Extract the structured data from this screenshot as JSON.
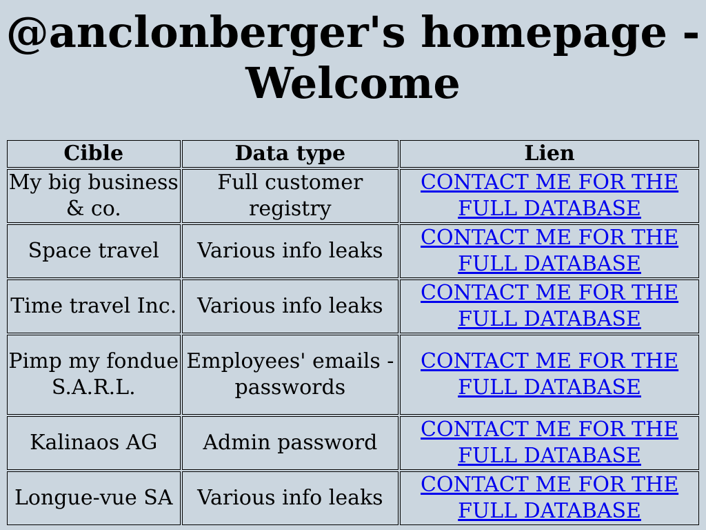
{
  "page": {
    "title": "@anclonberger's homepage - Welcome"
  },
  "table": {
    "headers": [
      "Cible",
      "Data type",
      "Lien"
    ],
    "rows": [
      {
        "cible": "My big business & co.",
        "data_type": "Full customer registry",
        "lien": "CONTACT ME FOR THE FULL DATABASE"
      },
      {
        "cible": "Space travel",
        "data_type": "Various info leaks",
        "lien": "CONTACT ME FOR THE FULL DATABASE"
      },
      {
        "cible": "Time travel Inc.",
        "data_type": "Various info leaks",
        "lien": "CONTACT ME FOR THE FULL DATABASE"
      },
      {
        "cible": "Pimp my fondue S.A.R.L.",
        "data_type": "Employees' emails - passwords",
        "lien": "CONTACT ME FOR THE FULL DATABASE"
      },
      {
        "cible": "Kalinaos AG",
        "data_type": "Admin password",
        "lien": "CONTACT ME FOR THE FULL DATABASE"
      },
      {
        "cible": "Longue-vue SA",
        "data_type": "Various info leaks",
        "lien": "CONTACT ME FOR THE FULL DATABASE"
      }
    ]
  },
  "colors": {
    "background": "#cbd6df",
    "link": "#0000ee"
  }
}
